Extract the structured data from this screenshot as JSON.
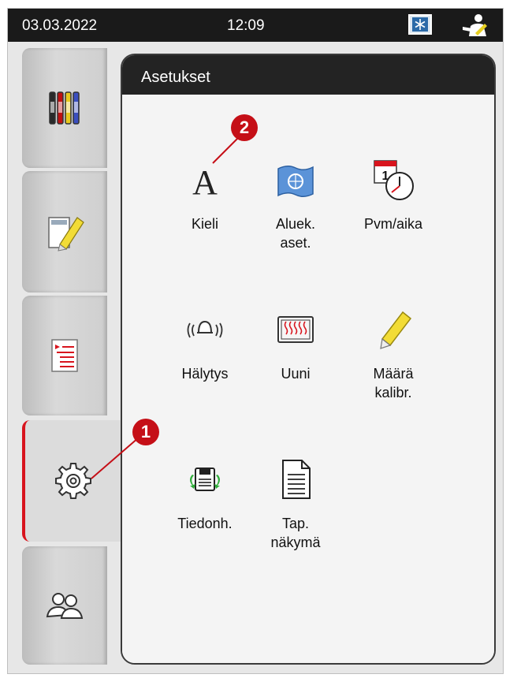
{
  "status": {
    "date": "03.03.2022",
    "time": "12:09"
  },
  "panel": {
    "title": "Asetukset"
  },
  "settings": [
    {
      "label": "Kieli",
      "icon": "language-icon"
    },
    {
      "label": "Aluek.\naset.",
      "icon": "region-flag-icon"
    },
    {
      "label": "Pvm/aika",
      "icon": "date-time-icon"
    },
    {
      "label": "Hälytys",
      "icon": "alarm-bell-icon"
    },
    {
      "label": "Uuni",
      "icon": "oven-icon"
    },
    {
      "label": "Määrä\nkalibr.",
      "icon": "marker-pen-icon"
    },
    {
      "label": "Tiedonh.",
      "icon": "data-management-icon"
    },
    {
      "label": "Tap.\nnäkymä",
      "icon": "event-view-icon"
    }
  ],
  "tabs": [
    {
      "name": "reagents",
      "icon": "reagent-vials-icon"
    },
    {
      "name": "slide-labeling",
      "icon": "slide-pen-icon"
    },
    {
      "name": "programs",
      "icon": "program-list-icon"
    },
    {
      "name": "settings",
      "icon": "gear-icon",
      "active": true
    },
    {
      "name": "user",
      "icon": "user-group-icon"
    }
  ],
  "callouts": [
    "1",
    "2"
  ],
  "colors": {
    "accent": "#d8141d",
    "callout": "#c50f17",
    "header": "#232323"
  }
}
